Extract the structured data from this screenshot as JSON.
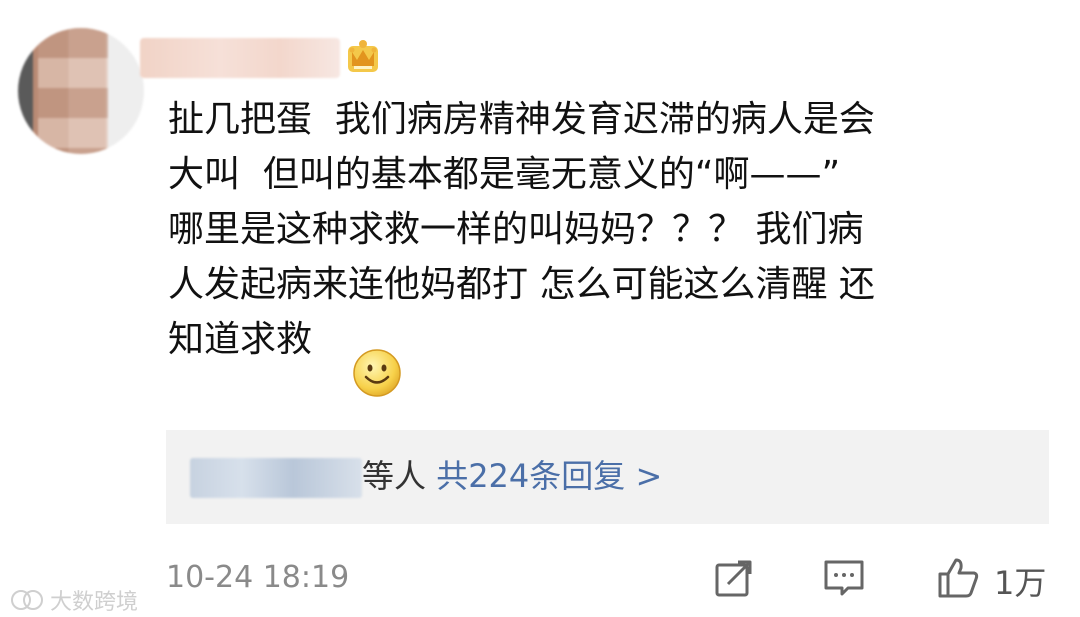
{
  "comment": {
    "text": "扯几把蛋  我们病房精神发育迟滞的病人是会\n大叫  但叫的基本都是毫无意义的“啊——”\n哪里是这种求救一样的叫妈妈？？？ 我们病\n人发起病来连他妈都打 怎么可能这么清醒 还\n知道求救"
  },
  "replies": {
    "suffix": "等人",
    "link": "共224条回复 >"
  },
  "meta": {
    "timestamp": "10-24 18:19",
    "like_count": "1万"
  },
  "watermark": {
    "text": "大数跨境"
  },
  "icons": {
    "crown": "crown-icon",
    "smiley": "smiley-icon",
    "share": "share-icon",
    "comment": "comment-icon",
    "like": "thumbs-up-icon"
  },
  "colors": {
    "link": "#4b6fa8",
    "meta": "#8a8a8a",
    "reply_bg": "#f2f2f2"
  }
}
